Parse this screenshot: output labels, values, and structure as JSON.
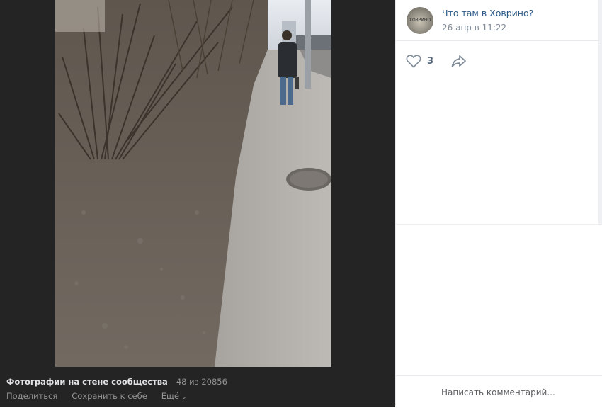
{
  "viewer": {
    "photo_alt": "",
    "album_title": "Фотографии на стене сообщества",
    "counter": "48 из 20856",
    "actions": {
      "share": "Поделиться",
      "save": "Сохранить к себе",
      "more": "Ещё"
    }
  },
  "post": {
    "author": "Что там в Ховрино?",
    "date": "26 апр в 11:22",
    "avatar_text": "ХОВРИНО",
    "likes": "3",
    "like_icon": "heart-icon",
    "share_icon": "share-arrow-icon"
  },
  "comment": {
    "placeholder": "Написать комментарий..."
  },
  "colors": {
    "viewer_bg": "#242424",
    "link": "#2a5885",
    "muted": "#818c99"
  }
}
